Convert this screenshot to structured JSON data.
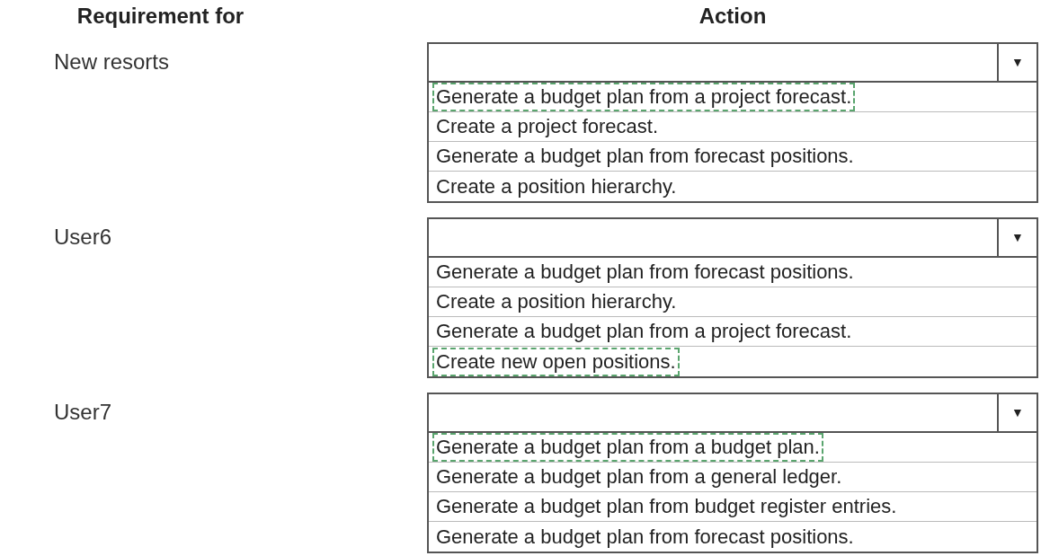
{
  "headers": {
    "requirement": "Requirement for",
    "action": "Action"
  },
  "requirements": [
    {
      "label": "New resorts",
      "dropdown_arrow": "▼",
      "options": [
        {
          "text": "Generate a budget plan from a project forecast.",
          "selected": true
        },
        {
          "text": "Create a project forecast.",
          "selected": false
        },
        {
          "text": "Generate a budget plan from forecast positions.",
          "selected": false
        },
        {
          "text": "Create a position hierarchy.",
          "selected": false
        }
      ]
    },
    {
      "label": "User6",
      "dropdown_arrow": "▼",
      "options": [
        {
          "text": "Generate a budget plan from forecast positions.",
          "selected": false
        },
        {
          "text": "Create a position hierarchy.",
          "selected": false
        },
        {
          "text": "Generate a budget plan from a project forecast.",
          "selected": false
        },
        {
          "text": "Create new open positions.",
          "selected": true
        }
      ]
    },
    {
      "label": "User7",
      "dropdown_arrow": "▼",
      "options": [
        {
          "text": "Generate a budget plan from a budget plan.",
          "selected": true
        },
        {
          "text": "Generate a budget plan from a general ledger.",
          "selected": false
        },
        {
          "text": "Generate a budget plan from budget register entries.",
          "selected": false
        },
        {
          "text": "Generate a budget plan from forecast positions.",
          "selected": false
        }
      ]
    }
  ]
}
